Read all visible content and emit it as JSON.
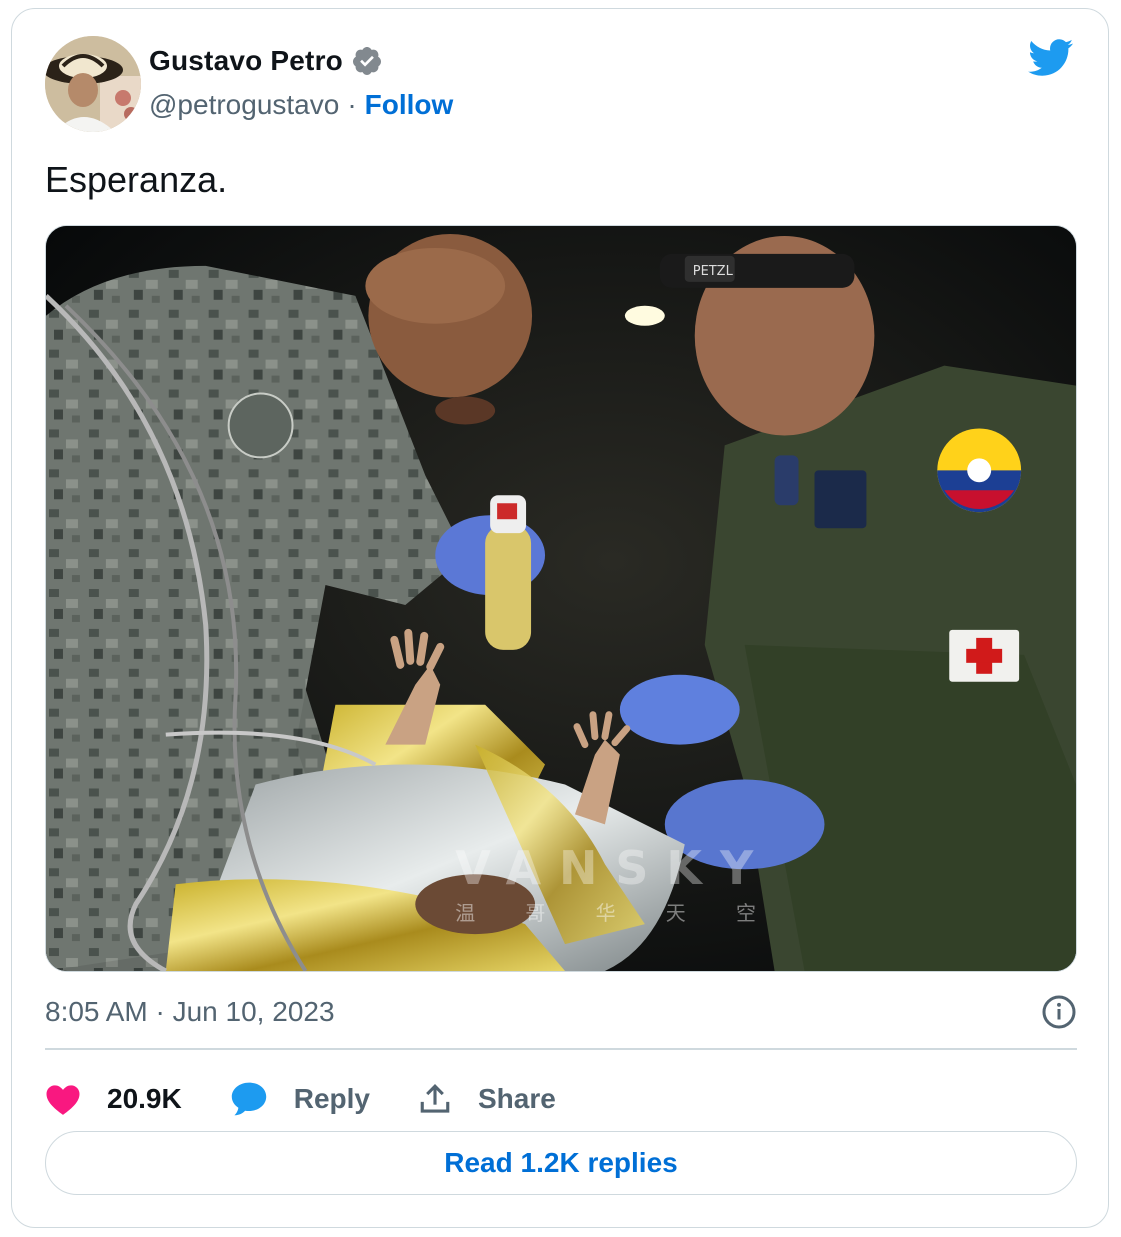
{
  "author": {
    "name": "Gustavo Petro",
    "handle": "@petrogustavo",
    "separator": "·",
    "follow_label": "Follow",
    "verified": true
  },
  "tweet": {
    "text": "Esperanza.",
    "timestamp": "8:05 AM · Jun 10, 2023"
  },
  "photo": {
    "patch_text": "PETZL",
    "watermark_text": "VANSKY",
    "watermark_subtitle": "温 哥 华 天 空"
  },
  "actions": {
    "like_count": "20.9K",
    "reply_label": "Reply",
    "share_label": "Share"
  },
  "footer": {
    "read_replies_label": "Read 1.2K replies"
  },
  "colors": {
    "brand_blue": "#1d9bf0",
    "link_blue": "#006fd6",
    "like_pink": "#f91880",
    "text_primary": "#0f1419",
    "text_secondary": "#536471",
    "border": "#cfd9de"
  },
  "icons": [
    "verified-badge-icon",
    "twitter-bird-icon",
    "info-icon",
    "heart-icon",
    "reply-bubble-icon",
    "share-upload-icon"
  ]
}
